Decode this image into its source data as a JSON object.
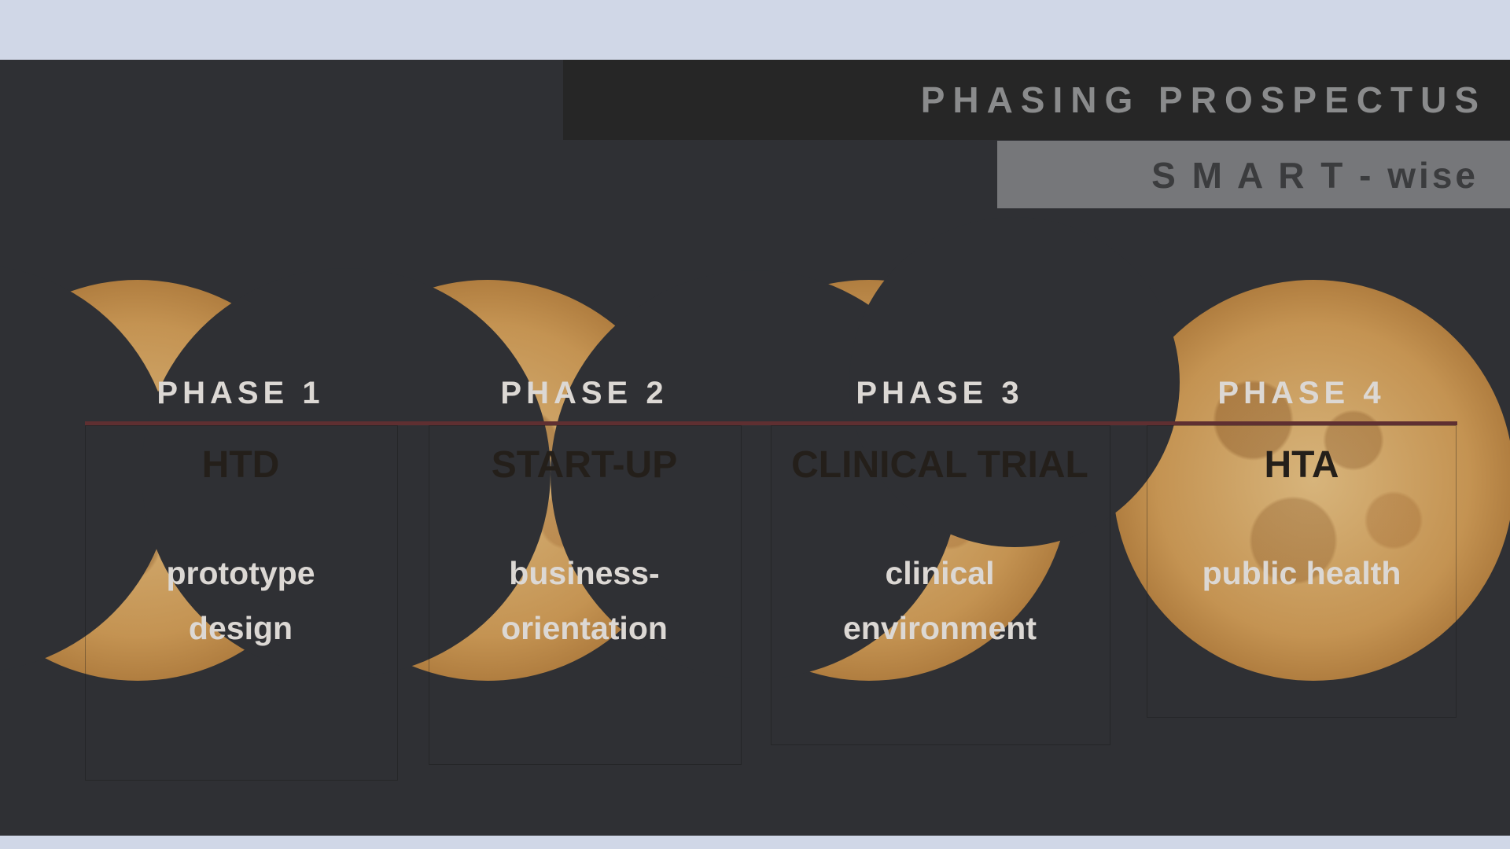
{
  "header": {
    "title": "PHASING PROSPECTUS",
    "subtitle": "S M A R T - wise"
  },
  "phases": [
    {
      "label": "PHASE 1",
      "name": "HTD",
      "desc_line1": "prototype",
      "desc_line2": "design"
    },
    {
      "label": "PHASE 2",
      "name": "START-UP",
      "desc_line1": "business-",
      "desc_line2": "orientation"
    },
    {
      "label": "PHASE 3",
      "name": "CLINICAL TRIAL",
      "desc_line1": "clinical",
      "desc_line2": "environment"
    },
    {
      "label": "PHASE 4",
      "name": "HTA",
      "desc_line1": "public health",
      "desc_line2": ""
    }
  ],
  "colors": {
    "background": "#d0d7e7",
    "slide": "#2f3034",
    "title_bar": "#262626",
    "subtitle_bar": "#76777a",
    "timeline": "#5f2f31",
    "moon": "#c49352"
  }
}
